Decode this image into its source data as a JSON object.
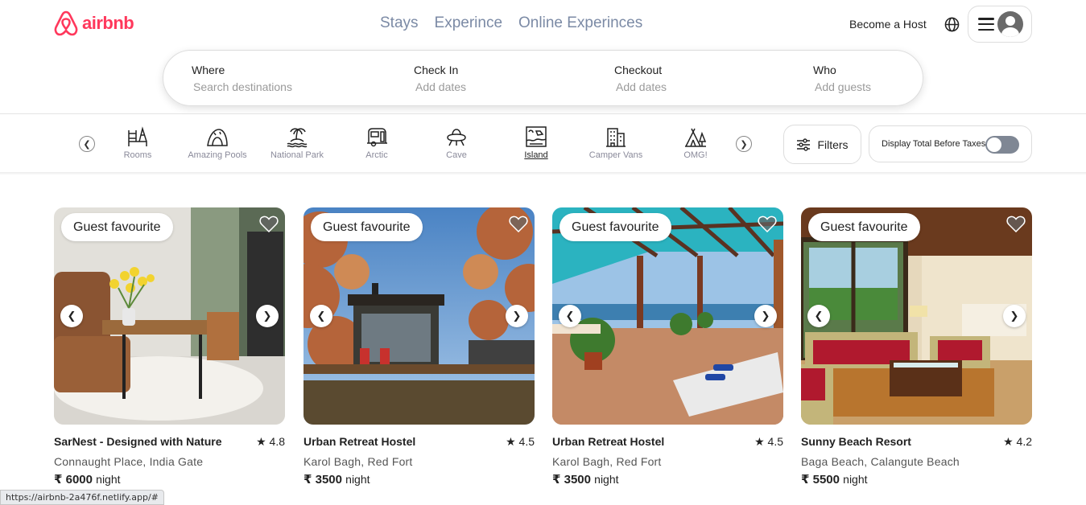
{
  "brand": {
    "name": "airbnb",
    "color": "#ff385c",
    "logo_icon": "airbnb-logo-icon"
  },
  "header": {
    "tabs": [
      {
        "label": "Stays"
      },
      {
        "label": "Experince"
      },
      {
        "label": "Online Experinces"
      }
    ],
    "host_label": "Become a Host",
    "globe_icon": "globe-icon",
    "menu_icon": "hamburger-menu-icon",
    "avatar_icon": "user-avatar-icon"
  },
  "search": {
    "where": {
      "label": "Where",
      "placeholder": "Search destinations"
    },
    "checkin": {
      "label": "Check In",
      "placeholder": "Add dates"
    },
    "checkout": {
      "label": "Checkout",
      "placeholder": "Add dates"
    },
    "who": {
      "label": "Who",
      "placeholder": "Add guests"
    }
  },
  "categories": {
    "prev_icon": "chevron-left-icon",
    "next_icon": "chevron-right-icon",
    "items": [
      {
        "label": "Rooms",
        "icon": "rooms-icon"
      },
      {
        "label": "Amazing Pools",
        "icon": "pool-icon"
      },
      {
        "label": "National Park",
        "icon": "island-palm-icon"
      },
      {
        "label": "Arctic",
        "icon": "camper-icon"
      },
      {
        "label": "Cave",
        "icon": "ufo-icon"
      },
      {
        "label": "Island",
        "icon": "island-map-icon",
        "active": true
      },
      {
        "label": "Camper Vans",
        "icon": "building-icon"
      },
      {
        "label": "OMG!",
        "icon": "tent-icon"
      }
    ],
    "filters_label": "Filters",
    "filters_icon": "sliders-icon",
    "taxes_label": "Display Total Before Taxes",
    "taxes_toggle_on": false
  },
  "listings": [
    {
      "badge": "Guest favourite",
      "title": "SarNest - Designed with Nature",
      "rating": "★ 4.8",
      "location": "Connaught Place, India Gate",
      "price": "₹ 6000",
      "unit": "night",
      "scene": "living-room-with-tulips"
    },
    {
      "badge": "Guest favourite",
      "title": "Urban Retreat Hostel",
      "rating": "★ 4.5",
      "location": "Karol Bagh, Red Fort",
      "price": "₹ 3500",
      "unit": "night",
      "scene": "cabin-in-autumn-forest"
    },
    {
      "badge": "Guest favourite",
      "title": "Urban Retreat Hostel",
      "rating": "★ 4.5",
      "location": "Karol Bagh, Red Fort",
      "price": "₹ 3500",
      "unit": "night",
      "scene": "pergola-terrace-sea-view"
    },
    {
      "badge": "Guest favourite",
      "title": "Sunny Beach Resort",
      "rating": "★ 4.2",
      "location": "Baga Beach, Calangute Beach",
      "price": "₹ 5500",
      "unit": "night",
      "scene": "resort-room-red-sofas"
    }
  ],
  "status_bar": {
    "url": "https://airbnb-2a476f.netlify.app/#"
  }
}
